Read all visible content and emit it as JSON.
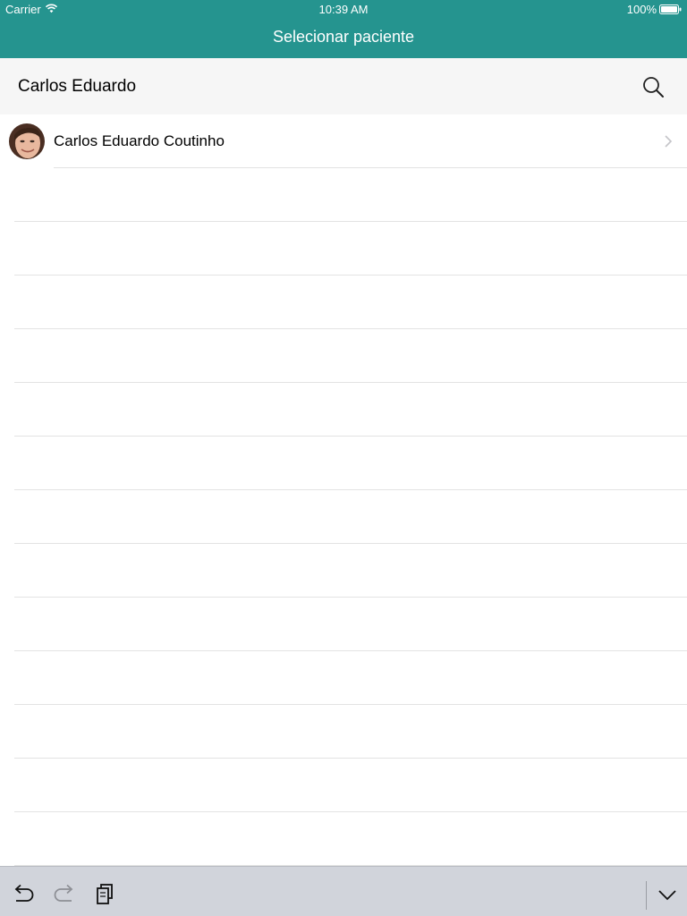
{
  "status_bar": {
    "carrier": "Carrier",
    "time": "10:39 AM",
    "battery": "100%"
  },
  "nav": {
    "title": "Selecionar paciente"
  },
  "search": {
    "value": "Carlos Eduardo",
    "icon": "search-icon"
  },
  "patients": [
    {
      "name": "Carlos Eduardo Coutinho",
      "avatar": "patient-photo"
    }
  ],
  "keyboard_toolbar": {
    "undo_icon": "undo-icon",
    "redo_icon": "redo-icon",
    "paste_icon": "paste-icon",
    "dismiss_icon": "chevron-down-icon"
  },
  "colors": {
    "header": "#25948f",
    "search_bar": "#f6f6f6",
    "separator": "#e3e3e3",
    "keyboard_bar": "#d1d4db"
  }
}
